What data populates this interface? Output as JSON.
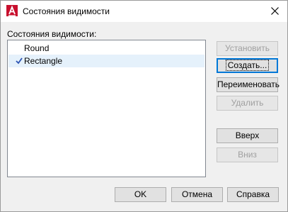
{
  "window": {
    "title": "Состояния видимости"
  },
  "list": {
    "label": "Состояния видимости:",
    "items": [
      {
        "label": "Round",
        "checked": false
      },
      {
        "label": "Rectangle",
        "checked": true
      }
    ]
  },
  "side_buttons": {
    "set_current": "Установить",
    "create": "Создать...",
    "rename": "Переименовать",
    "delete": "Удалить",
    "move_up": "Вверх",
    "move_down": "Вниз"
  },
  "footer_buttons": {
    "ok": "OK",
    "cancel": "Отмена",
    "help": "Справка"
  },
  "colors": {
    "accent": "#0078d7",
    "app_icon": "#c8102e",
    "check": "#2d54b3"
  },
  "icons": {
    "app": "autocad-app-icon",
    "close": "close-icon",
    "check": "checkmark-icon"
  }
}
